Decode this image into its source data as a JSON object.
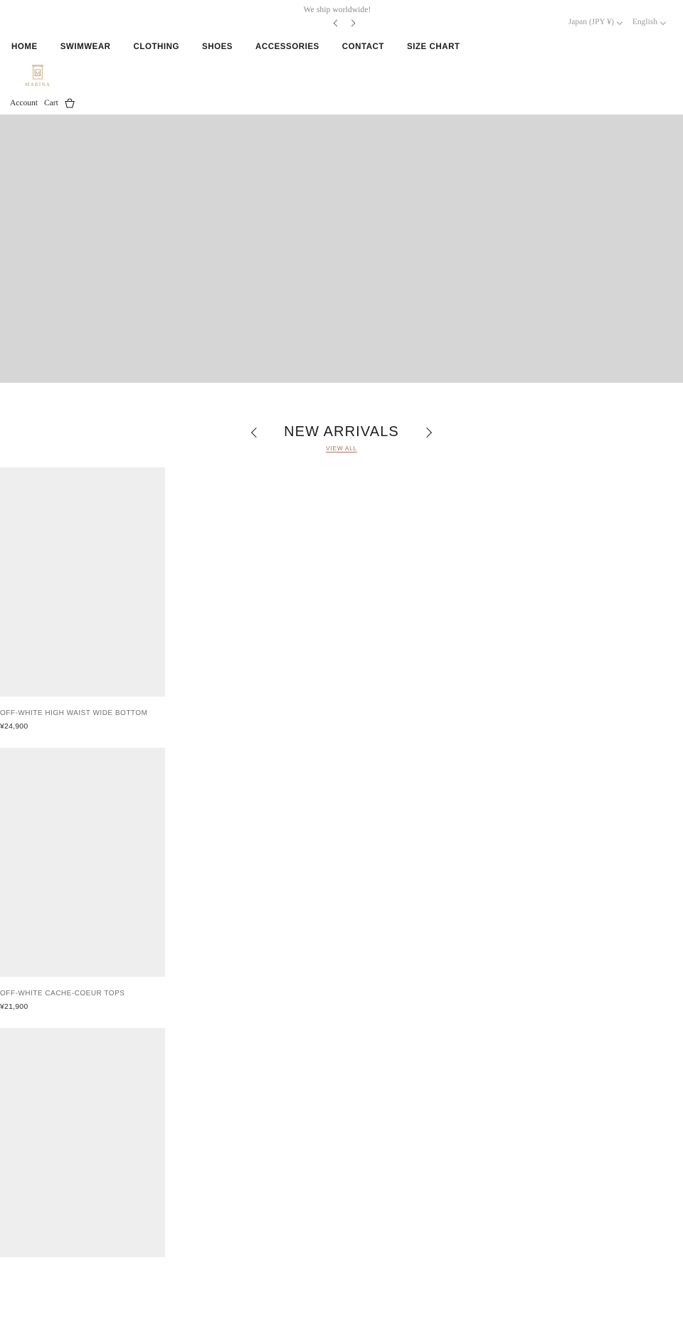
{
  "announcement": {
    "text": "We ship worldwide!",
    "prev_label": "Previous announcement",
    "next_label": "Next announcement"
  },
  "locale": {
    "currency": "Japan (JPY ¥)",
    "language": "English"
  },
  "nav": {
    "items": [
      {
        "label": "HOME"
      },
      {
        "label": "SWIMWEAR"
      },
      {
        "label": "CLOTHING"
      },
      {
        "label": "SHOES"
      },
      {
        "label": "ACCESSORIES"
      },
      {
        "label": "CONTACT"
      },
      {
        "label": "SIZE CHART"
      }
    ]
  },
  "brand": {
    "wordmark": "MARINA",
    "monogram": "M",
    "logo_color": "#c2a173"
  },
  "utility": {
    "account_label": "Account",
    "cart_label": "Cart",
    "cart_icon": "shopping-basket-icon"
  },
  "hero": {
    "background_color": "#d6d6d6"
  },
  "section": {
    "title": "NEW ARRIVALS",
    "view_all_label": "VIEW ALL",
    "view_all_color": "#a9705f",
    "prev_label": "Previous products",
    "next_label": "Next products"
  },
  "products": [
    {
      "title": "OFF-WHITE HIGH WAIST WIDE BOTTOM",
      "price": "¥24,900"
    },
    {
      "title": "OFF-WHITE CACHE-COEUR TOPS",
      "price": "¥21,900"
    },
    {
      "title": "",
      "price": ""
    }
  ]
}
